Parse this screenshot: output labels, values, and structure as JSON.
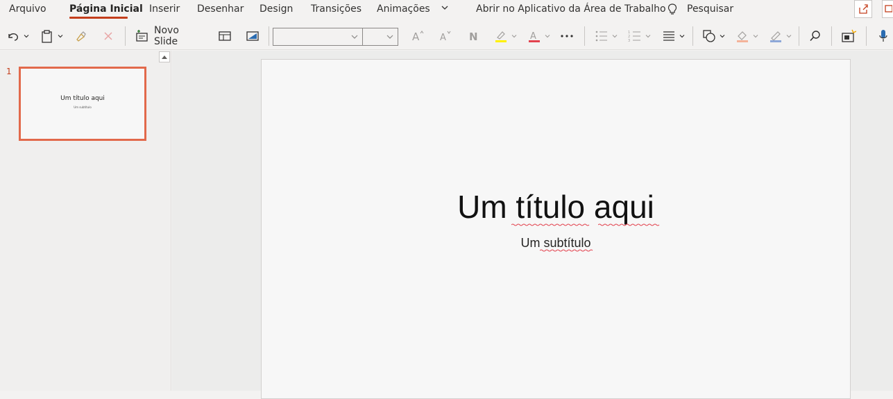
{
  "menu": {
    "file": "Arquivo",
    "home": "Página Inicial",
    "insert": "Inserir",
    "draw": "Desenhar",
    "design": "Design",
    "transitions": "Transições",
    "animations": "Animações",
    "open_desktop": "Abrir no Aplicativo da Área de Trabalho",
    "search": "Pesquisar"
  },
  "ribbon": {
    "new_slide": "Novo Slide",
    "font_name": "",
    "font_size": ""
  },
  "thumbnails": [
    {
      "number": "1",
      "title": "Um título aqui",
      "subtitle": "Um subtítulo"
    }
  ],
  "slide": {
    "title": "Um título aqui",
    "subtitle": "Um subtítulo"
  },
  "colors": {
    "accent": "#c43e1c",
    "thumb_border": "#e2694b",
    "highlight": "#fff100",
    "font_color": "#e2424e"
  }
}
